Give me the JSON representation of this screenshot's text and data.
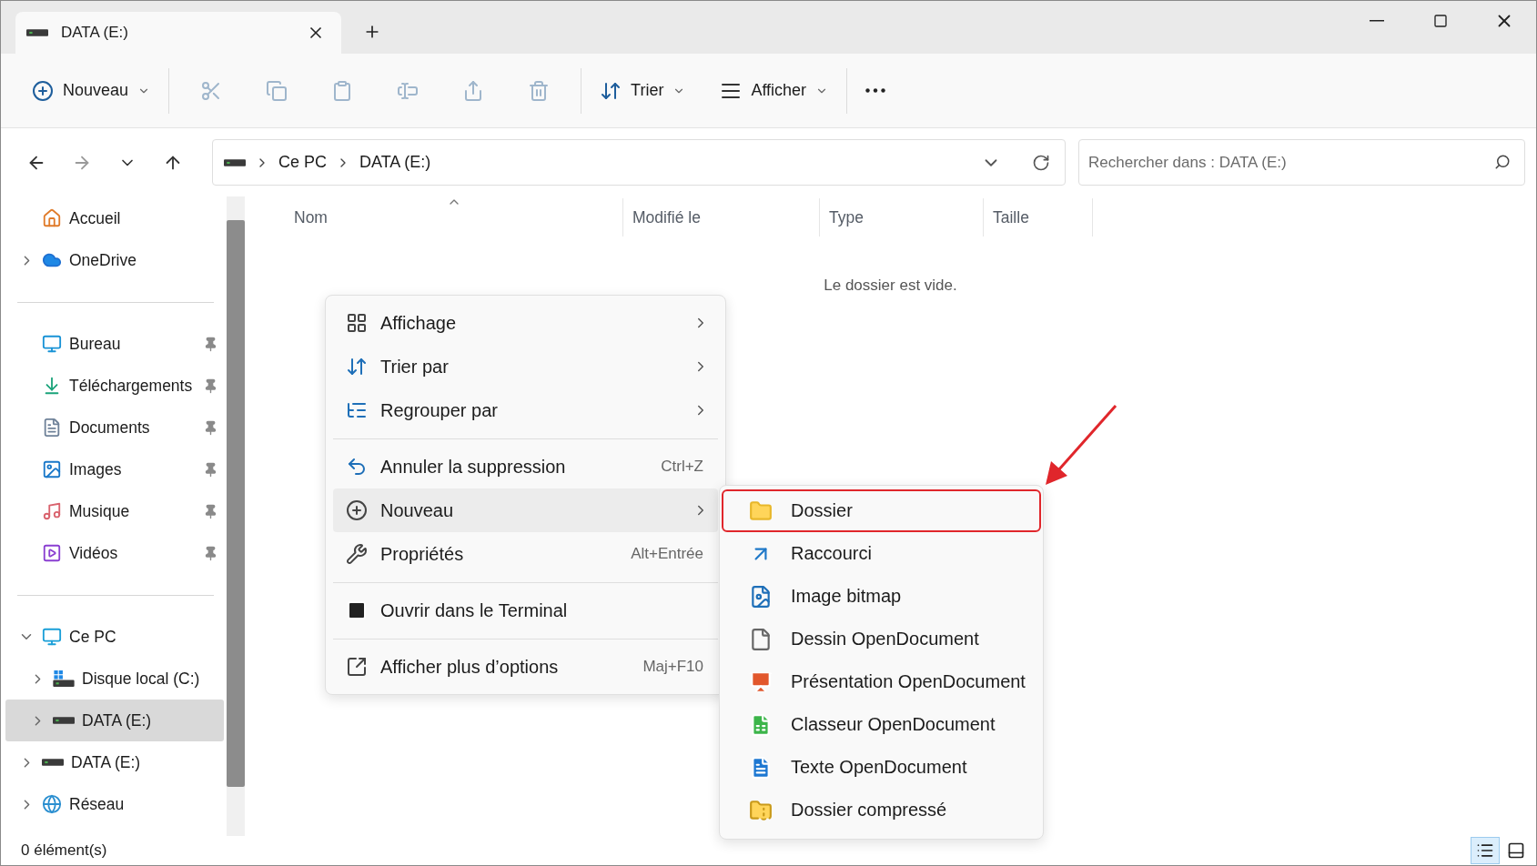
{
  "window": {
    "tab": {
      "title": "DATA (E:)"
    }
  },
  "toolbar": {
    "new_label": "Nouveau",
    "actions": [
      {
        "kind": "cut",
        "disabled": true
      },
      {
        "kind": "copy",
        "disabled": true
      },
      {
        "kind": "paste",
        "disabled": true
      },
      {
        "kind": "rename",
        "disabled": true
      },
      {
        "kind": "share",
        "disabled": true
      },
      {
        "kind": "delete",
        "disabled": true
      }
    ],
    "sort_label": "Trier",
    "view_label": "Afficher"
  },
  "address": {
    "crumbs": [
      "Ce PC",
      "DATA (E:)"
    ]
  },
  "search": {
    "placeholder": "Rechercher dans : DATA (E:)"
  },
  "sidebar": {
    "groups": [
      [
        {
          "label": "Accueil",
          "kind": "home",
          "pinned": false,
          "selected": false
        },
        {
          "label": "OneDrive",
          "kind": "cloud",
          "pinned": false,
          "expanded": false,
          "selected": false
        }
      ],
      [
        {
          "label": "Bureau",
          "kind": "desktop",
          "pinned": true,
          "selected": false
        },
        {
          "label": "Téléchargements",
          "kind": "download",
          "pinned": true,
          "selected": false
        },
        {
          "label": "Documents",
          "kind": "documents",
          "pinned": true,
          "selected": false
        },
        {
          "label": "Images",
          "kind": "images",
          "pinned": true,
          "selected": false
        },
        {
          "label": "Musique",
          "kind": "music",
          "pinned": true,
          "selected": false
        },
        {
          "label": "Vidéos",
          "kind": "videos",
          "pinned": true,
          "selected": false
        }
      ],
      [
        {
          "label": "Ce PC",
          "kind": "pc",
          "pinned": false,
          "expanded": true,
          "selected": false,
          "children": [
            {
              "label": "Disque local (C:)",
              "kind": "system-drive",
              "pinned": false,
              "expanded": false,
              "selected": false
            },
            {
              "label": "DATA (E:)",
              "kind": "drive",
              "pinned": false,
              "expanded": false,
              "selected": true
            }
          ]
        },
        {
          "label": "DATA (E:)",
          "kind": "drive",
          "pinned": false,
          "expanded": false,
          "selected": false
        },
        {
          "label": "Réseau",
          "kind": "network",
          "pinned": false,
          "expanded": false,
          "selected": false
        }
      ]
    ]
  },
  "table": {
    "columns": [
      {
        "label": "Nom",
        "sorted": true
      },
      {
        "label": "Modifié le",
        "sorted": false
      },
      {
        "label": "Type",
        "sorted": false
      },
      {
        "label": "Taille",
        "sorted": false
      }
    ],
    "empty_message": "Le dossier est vide."
  },
  "context_menu": {
    "items": [
      {
        "kind": "item",
        "label": "Affichage",
        "submenu": true,
        "highlighted": false
      },
      {
        "kind": "item",
        "label": "Trier par",
        "submenu": true,
        "highlighted": false
      },
      {
        "kind": "item",
        "label": "Regrouper par",
        "submenu": true,
        "highlighted": false
      },
      {
        "kind": "separator"
      },
      {
        "kind": "item",
        "label": "Annuler la suppression",
        "shortcut": "Ctrl+Z",
        "submenu": false,
        "highlighted": false
      },
      {
        "kind": "item",
        "label": "Nouveau",
        "submenu": true,
        "highlighted": true
      },
      {
        "kind": "item",
        "label": "Propriétés",
        "shortcut": "Alt+Entrée",
        "submenu": false,
        "highlighted": false
      },
      {
        "kind": "separator"
      },
      {
        "kind": "item",
        "label": "Ouvrir dans le Terminal",
        "submenu": false,
        "highlighted": false
      },
      {
        "kind": "separator"
      },
      {
        "kind": "item",
        "label": "Afficher plus d’options",
        "shortcut": "Maj+F10",
        "submenu": false,
        "highlighted": false
      }
    ]
  },
  "submenu": {
    "items": [
      {
        "kind": "folder",
        "label": "Dossier",
        "marked": true
      },
      {
        "kind": "shortcut",
        "label": "Raccourci",
        "marked": false
      },
      {
        "kind": "bitmap",
        "label": "Image bitmap",
        "marked": false
      },
      {
        "kind": "blank",
        "label": "Dessin OpenDocument",
        "marked": false
      },
      {
        "kind": "presentation",
        "label": "Présentation OpenDocument",
        "marked": false
      },
      {
        "kind": "spreadsheet",
        "label": "Classeur OpenDocument",
        "marked": false
      },
      {
        "kind": "text",
        "label": "Texte OpenDocument",
        "marked": false
      },
      {
        "kind": "zip",
        "label": "Dossier compressé",
        "marked": false
      }
    ]
  },
  "status_bar": {
    "count": "0 élément(s)",
    "views": [
      {
        "kind": "details",
        "selected": true
      },
      {
        "kind": "tiles",
        "selected": false
      }
    ]
  }
}
